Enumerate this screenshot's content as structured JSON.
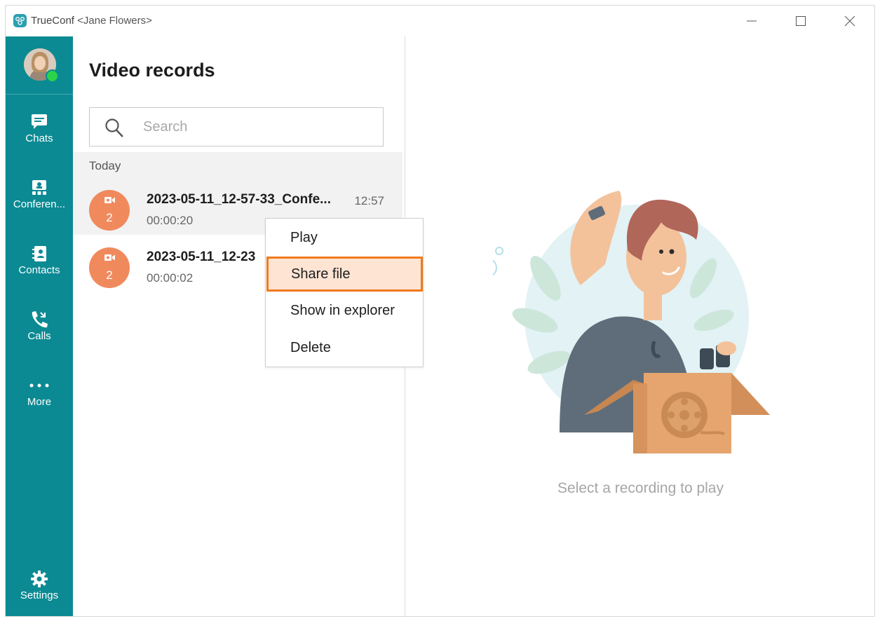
{
  "window": {
    "app_name": "TrueConf",
    "user": "<Jane Flowers>",
    "controls": {
      "minimize_icon": "minimize-icon",
      "maximize_icon": "maximize-icon",
      "close_icon": "close-icon"
    }
  },
  "sidebar": {
    "items": [
      {
        "label": "Chats",
        "icon": "chat-icon"
      },
      {
        "label": "Conferen...",
        "icon": "conference-icon"
      },
      {
        "label": "Contacts",
        "icon": "contacts-icon"
      },
      {
        "label": "Calls",
        "icon": "calls-icon"
      },
      {
        "label": "More",
        "icon": "more-icon"
      }
    ],
    "settings": {
      "label": "Settings",
      "icon": "gear-icon"
    },
    "status_color": "#2bd34a"
  },
  "list": {
    "title": "Video records",
    "search": {
      "placeholder": "Search",
      "value": ""
    },
    "group": "Today",
    "records": [
      {
        "name": "2023-05-11_12-57-33_Confe...",
        "time": "12:57",
        "duration": "00:00:20",
        "participants": "2"
      },
      {
        "name": "2023-05-11_12-23",
        "time": "",
        "duration": "00:00:02",
        "participants": "2"
      }
    ]
  },
  "context_menu": {
    "items": [
      "Play",
      "Share file",
      "Show in explorer",
      "Delete"
    ],
    "highlighted": "Share file"
  },
  "viewer": {
    "empty_message": "Select a recording to play"
  },
  "colors": {
    "sidebar": "#0b8a93",
    "record_avatar": "#f08a5d",
    "highlight_border": "#f07a1c",
    "highlight_fill": "#fde4d3"
  }
}
